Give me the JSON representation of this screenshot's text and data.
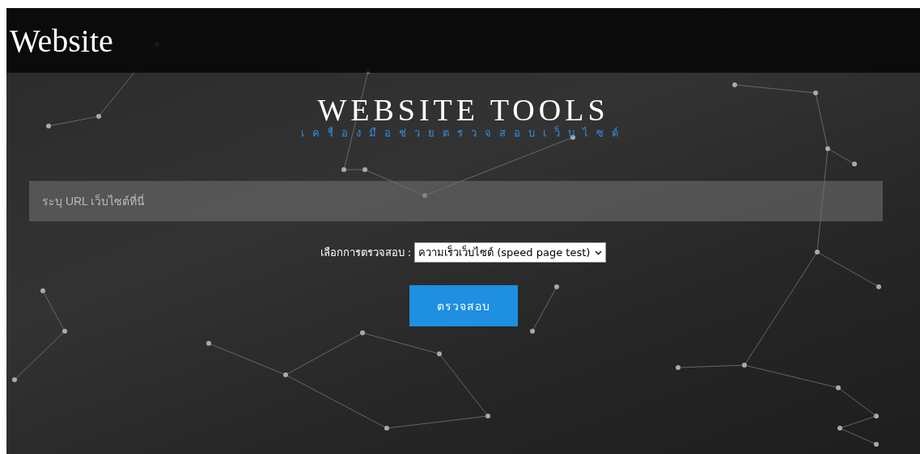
{
  "header": {
    "title": "Website"
  },
  "hero": {
    "title": "WEBSITE TOOLS",
    "subtitle": "เครื่องมือช่วยตรวจสอบเว็บไซต์"
  },
  "url_field": {
    "placeholder": "ระบุ URL เว็บไซต์ที่นี่"
  },
  "check_type": {
    "label": "เลือกการตรวจสอบ :",
    "value": "ความเร็วเว็บไซต์ (speed page test)"
  },
  "submit_button": {
    "label": "ตรวจสอบ"
  }
}
